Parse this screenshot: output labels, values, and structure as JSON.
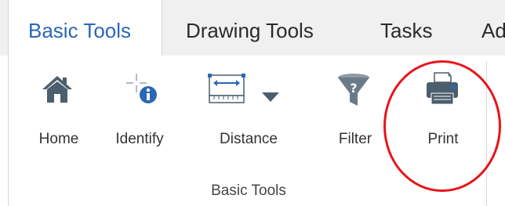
{
  "tabs": [
    {
      "label": "Basic Tools",
      "active": true
    },
    {
      "label": "Drawing Tools",
      "active": false
    },
    {
      "label": "Tasks",
      "active": false
    },
    {
      "label": "Ad",
      "active": false
    }
  ],
  "ribbon": {
    "group_label": "Basic Tools",
    "tools": [
      {
        "label": "Home",
        "icon": "home-icon"
      },
      {
        "label": "Identify",
        "icon": "identify-icon"
      },
      {
        "label": "Distance",
        "icon": "measure-distance-icon",
        "has_dropdown": true
      },
      {
        "label": "Filter",
        "icon": "filter-funnel-icon"
      },
      {
        "label": "Print",
        "icon": "printer-icon",
        "highlighted": true
      }
    ]
  },
  "colors": {
    "active_tab_text": "#2a67b4",
    "icon_gray": "#4b5e6d",
    "info_blue": "#2a67b4",
    "highlight_red": "#e8141b"
  }
}
